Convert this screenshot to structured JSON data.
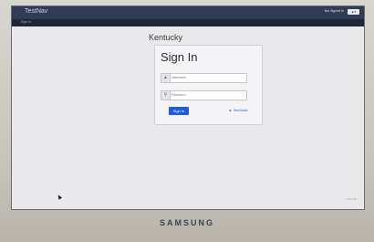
{
  "app": {
    "title": "TestNav",
    "sign_status": "Not Signed In",
    "user_menu": "▲▾",
    "subnav": "Sign In"
  },
  "main": {
    "state": "Kentucky",
    "form_title": "Sign In",
    "username_placeholder": "Username",
    "password_placeholder": "Password",
    "sign_in_label": "Sign In",
    "test_audio_label": "Test Audio",
    "version": "2.11.0.0"
  },
  "device": {
    "brand": "SAMSUNG"
  },
  "colors": {
    "header": "#2e3c55",
    "accent": "#1e5ae0"
  },
  "icons": [
    "user-icon",
    "key-icon",
    "speaker-icon",
    "cursor-icon"
  ]
}
